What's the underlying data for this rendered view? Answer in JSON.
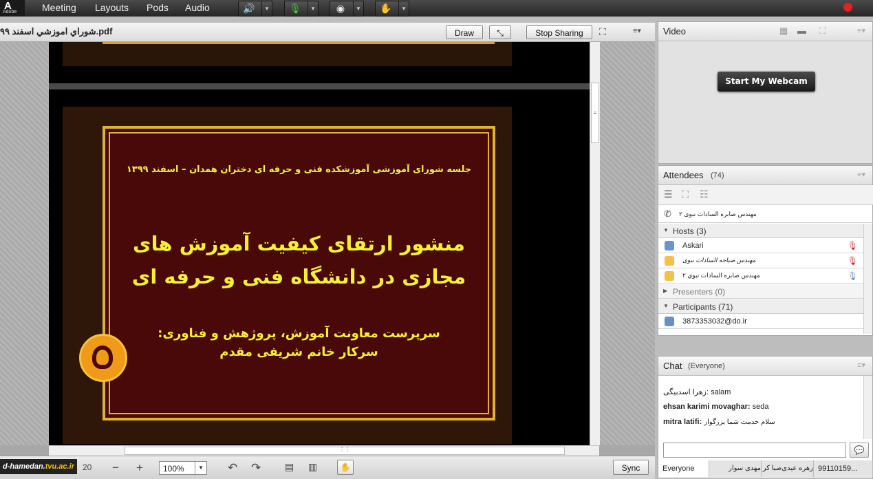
{
  "app": {
    "logo_letter": "A",
    "logo_text": "Adobe"
  },
  "menu": [
    "Meeting",
    "Layouts",
    "Pods",
    "Audio"
  ],
  "toolbar_icons": [
    "speaker-icon",
    "microphone-muted-icon",
    "webcam-icon",
    "raise-hand-icon"
  ],
  "share": {
    "filename": "شوراي اموزشي اسفند ۹۹.pdf",
    "draw_label": "Draw",
    "stop_sharing_label": "Stop Sharing"
  },
  "slide": {
    "header": "جلسه شورای آموزشی آموزشکده فنی و حرفه ای دختران همدان – اسفند ۱۳۹۹",
    "title_line1": "منشور ارتقای کیفیت آموزش های",
    "title_line2": "مجازی در دانشگاه فنی و حرفه ای",
    "subtitle_line1": "سرپرست معاونت آموزش، پروژهش و فناوری:",
    "subtitle_line2": "سرکار خانم شریفی مقدم"
  },
  "bottom": {
    "page": "20",
    "zoom": "100%",
    "sync_label": "Sync"
  },
  "watermark": {
    "prefix": "d-hamedan.",
    "domain": "tvu.ac.ir"
  },
  "video": {
    "title": "Video",
    "webcam_button": "Start My Webcam"
  },
  "attendees": {
    "title": "Attendees",
    "count": "(74)",
    "speaker": "مهندس صابره السادات نبوی ۲",
    "hosts_label": "Hosts (3)",
    "hosts": [
      "Askari",
      "مهندس صباحه السادات نبوی",
      "مهندس صابره السادات نبوي ۲"
    ],
    "presenters_label": "Presenters (0)",
    "participants_label": "Participants (71)",
    "participants": [
      "3873353032@do.ir"
    ]
  },
  "chat": {
    "title": "Chat",
    "scope": "(Everyone)",
    "messages": [
      {
        "name": "زهرا اسدبیگی:",
        "text": "salam"
      },
      {
        "name": "ehsan karimi movaghar:",
        "text": "seda"
      },
      {
        "name": "mitra latifi:",
        "text": "سلام خدمت شما بزرگوار"
      }
    ],
    "tabs": [
      "Everyone",
      "مهدی سوار",
      "زهره عیدی‌صبا کر",
      "99110159..."
    ]
  }
}
